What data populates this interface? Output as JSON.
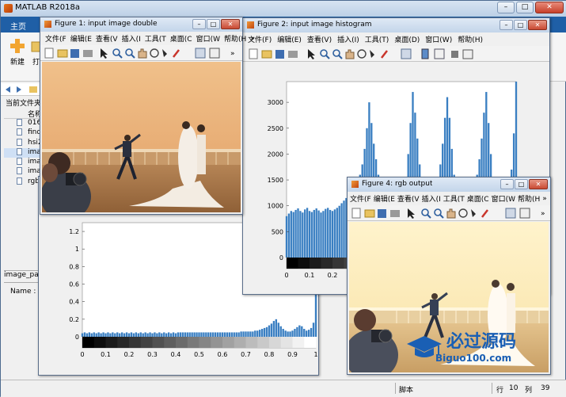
{
  "main_window": {
    "title": "MATLAB R2018a",
    "tabs": [
      "主页"
    ],
    "ribbon_labels": [
      "新建",
      "打"
    ],
    "current_folder_label": "当前文件夹",
    "file_header": "名称",
    "files": [
      "016",
      "find",
      "hsi2",
      "ima",
      "ima",
      "ima",
      "rgb"
    ],
    "selected_file_index": 3,
    "details_header": "image_pa",
    "details_name": "Name : h",
    "status": {
      "script": "脚本",
      "row_label": "行",
      "row": "10",
      "col_label": "列",
      "col": "39"
    }
  },
  "menus": {
    "fig1": [
      "文件(F",
      "编辑(E",
      "查看(V",
      "插入(I",
      "工具(T",
      "桌面(C",
      "窗口(W",
      "帮助(H",
      "»"
    ],
    "fig2": [
      "文件(F)",
      "编辑(E)",
      "查看(V)",
      "插入(I)",
      "工具(T)",
      "桌面(D)",
      "窗口(W)",
      "帮助(H)"
    ],
    "fig4": [
      "文件(F",
      "编辑(E",
      "查看(V",
      "插入(I",
      "工具(T",
      "桌面(C",
      "窗口(W",
      "帮助(H",
      "»"
    ]
  },
  "figures": {
    "fig1": {
      "title": "Figure 1: input image double"
    },
    "fig2": {
      "title": "Figure 2: input image histogram"
    },
    "fig3": {
      "title": ""
    },
    "fig4": {
      "title": "Figure 4: rgb output"
    }
  },
  "icons": {
    "toolbar": [
      "new-file-icon",
      "open-folder-icon",
      "save-icon",
      "print-icon",
      "pointer-icon",
      "zoom-in-icon",
      "zoom-out-icon",
      "pan-hand-icon",
      "rotate-icon",
      "data-cursor-icon",
      "brush-icon",
      "link-icon",
      "colorbar-icon",
      "legend-icon"
    ]
  },
  "colors": {
    "histogram_bar": "#3a7fc2",
    "matlab_blue": "#1f5fa6",
    "warm_sky": "#f4c98c"
  },
  "watermark": {
    "text_cn": "必过源码",
    "text_en": "Biguo100.com"
  },
  "chart_data": [
    {
      "type": "bar",
      "chart": "fig2-histogram",
      "x_ticks": [
        "0",
        "0.1",
        "0.2"
      ],
      "y_ticks": [
        "0",
        "500",
        "1000",
        "1500",
        "2000",
        "2500",
        "3000"
      ],
      "xlim": [
        0,
        1
      ],
      "ylim": [
        0,
        3400
      ],
      "grayscale_colorbar": true,
      "series": [
        {
          "x": [
            0.0,
            0.01,
            0.02,
            0.03,
            0.04,
            0.05,
            0.06,
            0.07,
            0.08,
            0.09,
            0.1,
            0.11,
            0.12,
            0.13,
            0.14,
            0.15,
            0.16,
            0.17,
            0.18,
            0.19,
            0.2,
            0.21,
            0.22,
            0.23,
            0.24,
            0.25,
            0.26,
            0.27,
            0.28,
            0.29,
            0.3,
            0.31,
            0.32,
            0.33,
            0.34,
            0.35,
            0.36,
            0.37,
            0.38,
            0.39,
            0.4,
            0.41,
            0.42,
            0.43,
            0.44,
            0.45,
            0.46,
            0.47,
            0.48,
            0.49,
            0.5,
            0.51,
            0.52,
            0.53,
            0.54,
            0.55,
            0.56,
            0.57,
            0.58,
            0.59,
            0.6,
            0.61,
            0.62,
            0.63,
            0.64,
            0.65,
            0.66,
            0.67,
            0.68,
            0.69,
            0.7,
            0.71,
            0.72,
            0.73,
            0.74,
            0.75,
            0.76,
            0.77,
            0.78,
            0.79,
            0.8,
            0.81,
            0.82,
            0.83,
            0.84,
            0.85,
            0.86,
            0.87,
            0.88,
            0.89,
            0.9,
            0.91,
            0.92,
            0.93,
            0.94,
            0.95,
            0.96,
            0.97,
            0.98,
            0.99,
            1.0
          ],
          "values": [
            800,
            850,
            900,
            880,
            920,
            950,
            900,
            870,
            930,
            960,
            900,
            880,
            920,
            950,
            910,
            870,
            900,
            940,
            960,
            920,
            900,
            930,
            960,
            1000,
            1050,
            1100,
            1150,
            1100,
            1200,
            1300,
            1400,
            1500,
            1600,
            1800,
            2100,
            2500,
            3000,
            2600,
            2200,
            1900,
            1600,
            1400,
            1200,
            1000,
            900,
            800,
            700,
            650,
            700,
            800,
            900,
            1100,
            1500,
            2000,
            2600,
            3200,
            2800,
            2300,
            1800,
            1400,
            1100,
            1000,
            950,
            1000,
            1100,
            1300,
            1500,
            1800,
            2200,
            2700,
            3100,
            2700,
            2100,
            1600,
            1300,
            1100,
            1000,
            900,
            950,
            1000,
            1100,
            1200,
            1400,
            1600,
            1900,
            2300,
            2800,
            3200,
            2600,
            2000,
            1500,
            1200,
            1100,
            1000,
            950,
            1000,
            1100,
            1300,
            1700,
            2400,
            3400
          ]
        }
      ]
    },
    {
      "type": "bar",
      "chart": "fig3-histogram",
      "x_ticks": [
        "0",
        "0.1",
        "0.2",
        "0.3",
        "0.4",
        "0.5",
        "0.6",
        "0.7",
        "0.8",
        "0.9",
        "1"
      ],
      "y_ticks": [
        "0",
        "0.2",
        "0.4",
        "0.6",
        "0.8",
        "1",
        "1.2"
      ],
      "xlim": [
        0,
        1
      ],
      "grayscale_colorbar": true,
      "series": [
        {
          "x": [
            0.0,
            0.01,
            0.02,
            0.03,
            0.04,
            0.05,
            0.06,
            0.07,
            0.08,
            0.09,
            0.1,
            0.11,
            0.12,
            0.13,
            0.14,
            0.15,
            0.16,
            0.17,
            0.18,
            0.19,
            0.2,
            0.21,
            0.22,
            0.23,
            0.24,
            0.25,
            0.26,
            0.27,
            0.28,
            0.29,
            0.3,
            0.31,
            0.32,
            0.33,
            0.34,
            0.35,
            0.36,
            0.37,
            0.38,
            0.39,
            0.4,
            0.41,
            0.42,
            0.43,
            0.44,
            0.45,
            0.46,
            0.47,
            0.48,
            0.49,
            0.5,
            0.51,
            0.52,
            0.53,
            0.54,
            0.55,
            0.56,
            0.57,
            0.58,
            0.59,
            0.6,
            0.61,
            0.62,
            0.63,
            0.64,
            0.65,
            0.66,
            0.67,
            0.68,
            0.69,
            0.7,
            0.71,
            0.72,
            0.73,
            0.74,
            0.75,
            0.76,
            0.77,
            0.78,
            0.79,
            0.8,
            0.81,
            0.82,
            0.83,
            0.84,
            0.85,
            0.86,
            0.87,
            0.88,
            0.89,
            0.9,
            0.91,
            0.92,
            0.93,
            0.94,
            0.95,
            0.96,
            0.97,
            0.98,
            0.99,
            1.0
          ],
          "values": [
            0.04,
            0.05,
            0.04,
            0.05,
            0.04,
            0.05,
            0.04,
            0.05,
            0.04,
            0.05,
            0.04,
            0.05,
            0.04,
            0.05,
            0.04,
            0.05,
            0.04,
            0.05,
            0.04,
            0.05,
            0.04,
            0.05,
            0.04,
            0.05,
            0.04,
            0.05,
            0.04,
            0.05,
            0.04,
            0.05,
            0.04,
            0.05,
            0.04,
            0.05,
            0.04,
            0.05,
            0.04,
            0.05,
            0.04,
            0.05,
            0.04,
            0.05,
            0.05,
            0.05,
            0.05,
            0.05,
            0.05,
            0.05,
            0.05,
            0.05,
            0.05,
            0.05,
            0.05,
            0.05,
            0.05,
            0.05,
            0.05,
            0.05,
            0.05,
            0.05,
            0.05,
            0.05,
            0.05,
            0.05,
            0.05,
            0.05,
            0.05,
            0.05,
            0.06,
            0.06,
            0.06,
            0.06,
            0.06,
            0.06,
            0.07,
            0.07,
            0.08,
            0.09,
            0.1,
            0.11,
            0.13,
            0.15,
            0.18,
            0.2,
            0.16,
            0.12,
            0.09,
            0.07,
            0.06,
            0.06,
            0.07,
            0.09,
            0.11,
            0.13,
            0.12,
            0.09,
            0.07,
            0.08,
            0.1,
            0.16,
            0.5
          ]
        }
      ]
    }
  ]
}
